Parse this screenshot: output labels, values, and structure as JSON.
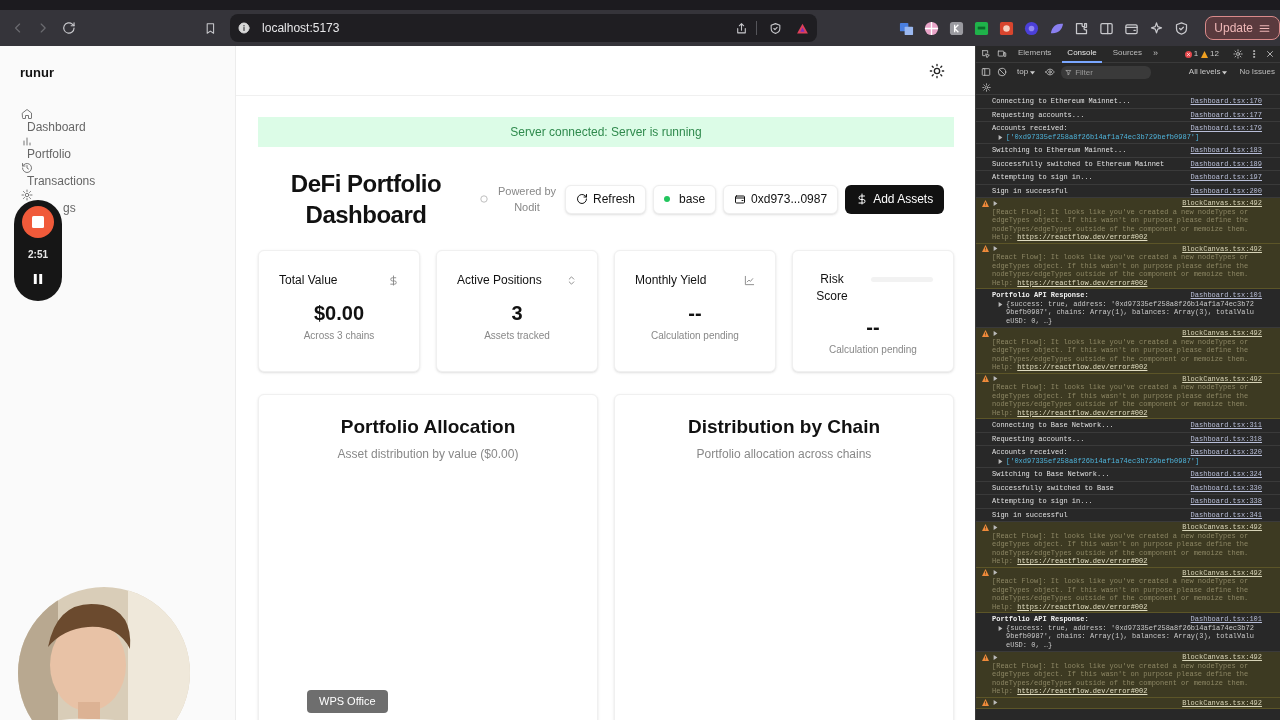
{
  "browser": {
    "url": "localhost:5173",
    "update_button": "Update"
  },
  "app": {
    "brand": "runur",
    "nav": [
      {
        "label": "Dashboard"
      },
      {
        "label": "Portfolio"
      },
      {
        "label": "Transactions"
      },
      {
        "label": "gs"
      }
    ],
    "banner": "Server connected: Server is running",
    "title": "DeFi Portfolio Dashboard",
    "powered_by": "Powered by Nodit",
    "refresh_button": "Refresh",
    "network": {
      "label": "base",
      "color": "#22c55e"
    },
    "wallet": "0xd973...0987",
    "add_button": "Add Assets",
    "stats": [
      {
        "kind": "stat",
        "label": "Total Value",
        "value": "$0.00",
        "note": "Across 3 chains"
      },
      {
        "kind": "stat",
        "label": "Active Positions",
        "value": "3",
        "note": "Assets tracked"
      },
      {
        "kind": "stat",
        "label": "Monthly Yield",
        "value": "--",
        "note": "Calculation pending"
      },
      {
        "kind": "meter",
        "label": "Risk Score",
        "level": 0,
        "value": "--",
        "note": "Calculation pending"
      }
    ],
    "charts": [
      {
        "title": "Portfolio Allocation",
        "subtitle": "Asset distribution by value ($0.00)"
      },
      {
        "title": "Distribution by Chain",
        "subtitle": "Portfolio allocation across chains"
      }
    ]
  },
  "recorder": {
    "time": "2:51"
  },
  "tooltip": "WPS Office",
  "devtools": {
    "tabs": [
      {
        "label": "Elements",
        "selected": false
      },
      {
        "label": "Console",
        "selected": true
      },
      {
        "label": "Sources",
        "selected": false
      }
    ],
    "more": "»",
    "errors": "1",
    "warnings": "12",
    "context": "top",
    "filter_placeholder": "Filter",
    "levels": "All levels",
    "issues": "No Issues",
    "messages": [
      {
        "kind": "log",
        "text": "Connecting to Ethereum Mainnet...",
        "source": "Dashboard.tsx:170"
      },
      {
        "kind": "log",
        "text": "Requesting accounts...",
        "source": "Dashboard.tsx:177"
      },
      {
        "kind": "log",
        "text": "Accounts received:",
        "source": "Dashboard.tsx:179",
        "detail": "['0xd97335ef258a8f26b14af1a74ec3b729befb0987']"
      },
      {
        "kind": "log",
        "text": "Switching to Ethereum Mainnet...",
        "source": "Dashboard.tsx:183"
      },
      {
        "kind": "log",
        "text": "Successfully switched to Ethereum Mainnet",
        "source": "Dashboard.tsx:189"
      },
      {
        "kind": "log",
        "text": "Attempting to sign in...",
        "source": "Dashboard.tsx:197"
      },
      {
        "kind": "log",
        "text": "Sign in successful",
        "source": "Dashboard.tsx:200"
      },
      {
        "kind": "warn",
        "text": "[React Flow]: It looks like you've created a new nodeTypes or edgeTypes object. If this wasn't on purpose please define the nodeTypes/edgeTypes outside of the component or memoize them. Help:",
        "link": "https://reactflow.dev/error#002",
        "source": "BlockCanvas.tsx:492"
      },
      {
        "kind": "warn",
        "text": "[React Flow]: It looks like you've created a new nodeTypes or edgeTypes object. If this wasn't on purpose please define the nodeTypes/edgeTypes outside of the component or memoize them. Help:",
        "link": "https://reactflow.dev/error#002",
        "source": "BlockCanvas.tsx:492"
      },
      {
        "kind": "object",
        "text": "Portfolio API Response:",
        "source": "Dashboard.tsx:101",
        "detail": "{success: true, address: '0xd97335ef258a8f26b14af1a74ec3b729befb0987', chains: Array(1), balances: Array(3), totalValueUSD: 0, …}"
      },
      {
        "kind": "warn",
        "text": "[React Flow]: It looks like you've created a new nodeTypes or edgeTypes object. If this wasn't on purpose please define the nodeTypes/edgeTypes outside of the component or memoize them. Help:",
        "link": "https://reactflow.dev/error#002",
        "source": "BlockCanvas.tsx:492"
      },
      {
        "kind": "warn",
        "text": "[React Flow]: It looks like you've created a new nodeTypes or edgeTypes object. If this wasn't on purpose please define the nodeTypes/edgeTypes outside of the component or memoize them. Help:",
        "link": "https://reactflow.dev/error#002",
        "source": "BlockCanvas.tsx:492"
      },
      {
        "kind": "log",
        "text": "Connecting to Base Network...",
        "source": "Dashboard.tsx:311"
      },
      {
        "kind": "log",
        "text": "Requesting accounts...",
        "source": "Dashboard.tsx:318"
      },
      {
        "kind": "log",
        "text": "Accounts received:",
        "source": "Dashboard.tsx:320",
        "detail": "['0xd97335ef258a8f26b14af1a74ec3b729befb0987']"
      },
      {
        "kind": "log",
        "text": "Switching to Base Network...",
        "source": "Dashboard.tsx:324"
      },
      {
        "kind": "log",
        "text": "Successfully switched to Base",
        "source": "Dashboard.tsx:330"
      },
      {
        "kind": "log",
        "text": "Attempting to sign in...",
        "source": "Dashboard.tsx:338"
      },
      {
        "kind": "log",
        "text": "Sign in successful",
        "source": "Dashboard.tsx:341"
      },
      {
        "kind": "warn",
        "text": "[React Flow]: It looks like you've created a new nodeTypes or edgeTypes object. If this wasn't on purpose please define the nodeTypes/edgeTypes outside of the component or memoize them. Help:",
        "link": "https://reactflow.dev/error#002",
        "source": "BlockCanvas.tsx:492"
      },
      {
        "kind": "warn",
        "text": "[React Flow]: It looks like you've created a new nodeTypes or edgeTypes object. If this wasn't on purpose please define the nodeTypes/edgeTypes outside of the component or memoize them. Help:",
        "link": "https://reactflow.dev/error#002",
        "source": "BlockCanvas.tsx:492"
      },
      {
        "kind": "object",
        "text": "Portfolio API Response:",
        "source": "Dashboard.tsx:101",
        "detail": "{success: true, address: '0xd97335ef258a8f26b14af1a74ec3b729befb0987', chains: Array(1), balances: Array(3), totalValueUSD: 0, …}"
      },
      {
        "kind": "warn",
        "text": "[React Flow]: It looks like you've created a new nodeTypes or edgeTypes object. If this wasn't on purpose please define the nodeTypes/edgeTypes outside of the component or memoize them. Help:",
        "link": "https://reactflow.dev/error#002",
        "source": "BlockCanvas.tsx:492"
      },
      {
        "kind": "warn",
        "source": "BlockCanvas.tsx:492"
      }
    ]
  }
}
